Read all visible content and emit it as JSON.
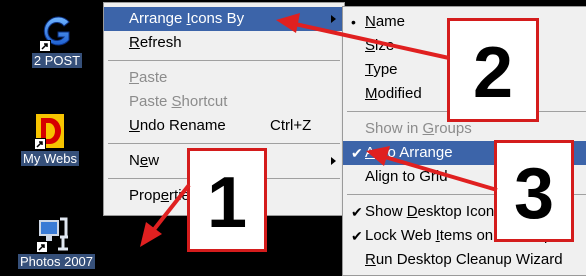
{
  "desktop_icons": [
    {
      "label": "2 POST",
      "selected": true,
      "icon": "g-letter-icon"
    },
    {
      "label": "My Webs",
      "selected": true,
      "icon": "red-d-icon"
    },
    {
      "label": "Photos 2007",
      "selected": true,
      "icon": "computer-chair-icon"
    }
  ],
  "context_menu": {
    "items": [
      {
        "label": "Arrange Icons By",
        "accel_index": 8,
        "submenu": true,
        "highlighted": true
      },
      {
        "label": "Refresh",
        "accel_index": 0
      },
      {
        "label": "Paste",
        "accel_index": 0,
        "disabled": true
      },
      {
        "label": "Paste Shortcut",
        "accel_index": 6,
        "disabled": true
      },
      {
        "label": "Undo Rename",
        "accel_index": 0,
        "shortcut": "Ctrl+Z"
      },
      {
        "label": "New",
        "accel_index": 1,
        "submenu": true
      },
      {
        "label": "Properties",
        "accel_index": 4
      }
    ]
  },
  "submenu": {
    "items": [
      {
        "label": "Name",
        "accel_index": 0,
        "mark": "•"
      },
      {
        "label": "Size",
        "accel_index": 0
      },
      {
        "label": "Type",
        "accel_index": 0
      },
      {
        "label": "Modified",
        "accel_index": 0
      },
      {
        "label": "Show in Groups",
        "accel_index": 8,
        "disabled": true
      },
      {
        "label": "Auto Arrange",
        "accel_index": 0,
        "mark": "✔",
        "highlighted": true
      },
      {
        "label": "Align to Grid",
        "accel_index": 3
      },
      {
        "label": "Show Desktop Icons",
        "accel_index": 5,
        "mark": "✔"
      },
      {
        "label": "Lock Web Items on Desktop",
        "accel_index": 9,
        "mark": "✔"
      },
      {
        "label": "Run Desktop Cleanup Wizard",
        "accel_index": 0
      }
    ]
  },
  "callouts": [
    "1",
    "2",
    "3"
  ],
  "colors": {
    "highlight": "#3c64a9",
    "callout_border": "#d41c1c",
    "arrow": "#e02020"
  }
}
